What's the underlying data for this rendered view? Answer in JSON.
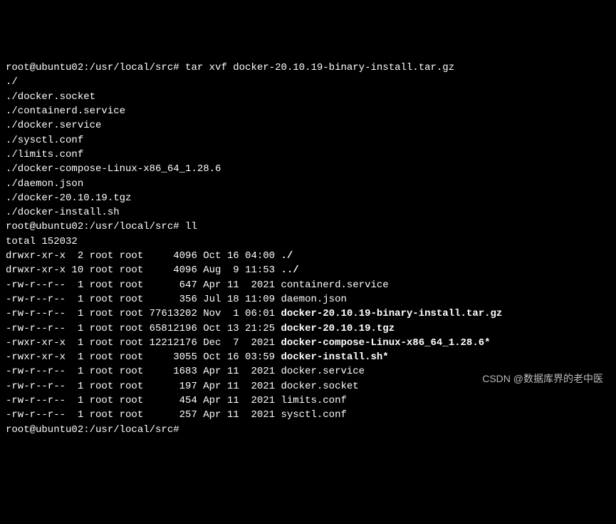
{
  "prompt": "root@ubuntu02:/usr/local/src#",
  "cmd1": "tar xvf docker-20.10.19-binary-install.tar.gz",
  "tar_output": [
    "./",
    "./docker.socket",
    "./containerd.service",
    "./docker.service",
    "./sysctl.conf",
    "./limits.conf",
    "./docker-compose-Linux-x86_64_1.28.6",
    "./daemon.json",
    "./docker-20.10.19.tgz",
    "./docker-install.sh"
  ],
  "cmd2": "ll",
  "ll_total": "total 152032",
  "ll_rows": [
    {
      "perm": "drwxr-xr-x",
      "ln": "2",
      "own": "root",
      "grp": "root",
      "size": "4096",
      "date": "Oct 16 04:00",
      "name": "./",
      "bold": true
    },
    {
      "perm": "drwxr-xr-x",
      "ln": "10",
      "own": "root",
      "grp": "root",
      "size": "4096",
      "date": "Aug  9 11:53",
      "name": "../",
      "bold": true
    },
    {
      "perm": "-rw-r--r--",
      "ln": "1",
      "own": "root",
      "grp": "root",
      "size": "647",
      "date": "Apr 11  2021",
      "name": "containerd.service",
      "bold": false
    },
    {
      "perm": "-rw-r--r--",
      "ln": "1",
      "own": "root",
      "grp": "root",
      "size": "356",
      "date": "Jul 18 11:09",
      "name": "daemon.json",
      "bold": false
    },
    {
      "perm": "-rw-r--r--",
      "ln": "1",
      "own": "root",
      "grp": "root",
      "size": "77613202",
      "date": "Nov  1 06:01",
      "name": "docker-20.10.19-binary-install.tar.gz",
      "bold": true
    },
    {
      "perm": "-rw-r--r--",
      "ln": "1",
      "own": "root",
      "grp": "root",
      "size": "65812196",
      "date": "Oct 13 21:25",
      "name": "docker-20.10.19.tgz",
      "bold": true
    },
    {
      "perm": "-rwxr-xr-x",
      "ln": "1",
      "own": "root",
      "grp": "root",
      "size": "12212176",
      "date": "Dec  7  2021",
      "name": "docker-compose-Linux-x86_64_1.28.6*",
      "bold": true
    },
    {
      "perm": "-rwxr-xr-x",
      "ln": "1",
      "own": "root",
      "grp": "root",
      "size": "3055",
      "date": "Oct 16 03:59",
      "name": "docker-install.sh*",
      "bold": true
    },
    {
      "perm": "-rw-r--r--",
      "ln": "1",
      "own": "root",
      "grp": "root",
      "size": "1683",
      "date": "Apr 11  2021",
      "name": "docker.service",
      "bold": false
    },
    {
      "perm": "-rw-r--r--",
      "ln": "1",
      "own": "root",
      "grp": "root",
      "size": "197",
      "date": "Apr 11  2021",
      "name": "docker.socket",
      "bold": false
    },
    {
      "perm": "-rw-r--r--",
      "ln": "1",
      "own": "root",
      "grp": "root",
      "size": "454",
      "date": "Apr 11  2021",
      "name": "limits.conf",
      "bold": false
    },
    {
      "perm": "-rw-r--r--",
      "ln": "1",
      "own": "root",
      "grp": "root",
      "size": "257",
      "date": "Apr 11  2021",
      "name": "sysctl.conf",
      "bold": false
    }
  ],
  "watermark": "CSDN @数据库界的老中医"
}
